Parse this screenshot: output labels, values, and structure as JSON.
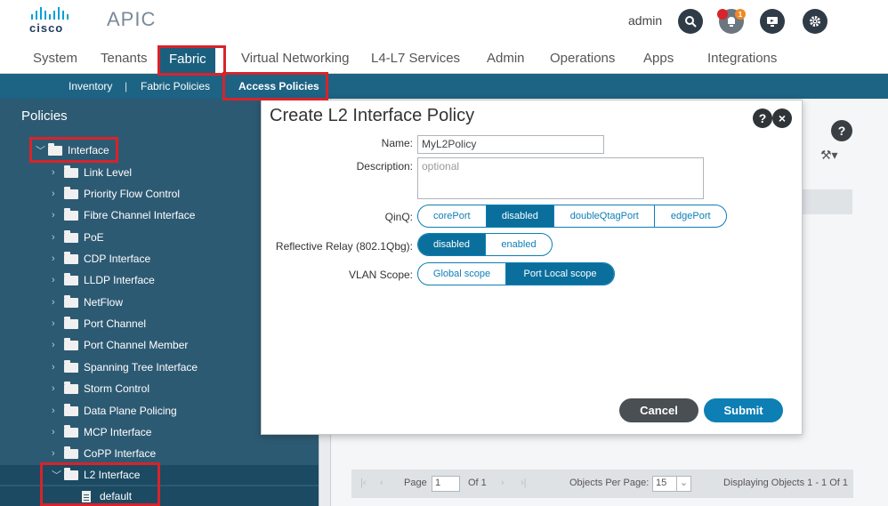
{
  "header": {
    "brand": "cisco",
    "app_title": "APIC",
    "user": "admin",
    "notification_count": "1",
    "icons": [
      "search-icon",
      "bell-icon",
      "screen-icon",
      "gear-icon"
    ]
  },
  "main_nav": {
    "tabs": [
      "System",
      "Tenants",
      "Fabric",
      "Virtual Networking",
      "L4-L7 Services",
      "Admin",
      "Operations",
      "Apps",
      "Integrations"
    ],
    "active": "Fabric"
  },
  "sub_nav": {
    "items": [
      "Inventory",
      "Fabric Policies",
      "Access Policies"
    ],
    "separator": "|",
    "active": "Access Policies"
  },
  "sidebar": {
    "title": "Policies",
    "root": "Interface",
    "items": [
      "Link Level",
      "Priority Flow Control",
      "Fibre Channel Interface",
      "PoE",
      "CDP Interface",
      "LLDP Interface",
      "NetFlow",
      "Port Channel",
      "Port Channel Member",
      "Spanning Tree Interface",
      "Storm Control",
      "Data Plane Policing",
      "MCP Interface",
      "CoPP Interface",
      "L2 Interface"
    ],
    "child": "default"
  },
  "right_pane": {
    "tools_glyph": "⚒▾",
    "pager": {
      "page_label": "Page",
      "page_value": "1",
      "of_label": "Of 1",
      "per_page_label": "Objects Per Page:",
      "per_page_value": "15",
      "display_text": "Displaying Objects 1 - 1 Of 1"
    }
  },
  "dialog": {
    "title": "Create L2 Interface Policy",
    "help": "?",
    "close": "×",
    "name_label": "Name:",
    "name_value": "MyL2Policy",
    "description_label": "Description:",
    "description_placeholder": "optional",
    "qinq_label": "QinQ:",
    "qinq_options": [
      "corePort",
      "disabled",
      "doubleQtagPort",
      "edgePort"
    ],
    "qinq_selected": "disabled",
    "reflective_label": "Reflective Relay (802.1Qbg):",
    "reflective_options": [
      "disabled",
      "enabled"
    ],
    "reflective_selected": "disabled",
    "vlan_label": "VLAN Scope:",
    "vlan_options": [
      "Global scope",
      "Port Local scope"
    ],
    "vlan_selected": "Port Local scope",
    "cancel_label": "Cancel",
    "submit_label": "Submit"
  },
  "colors": {
    "accent": "#0a6f9c",
    "nav_active": "#1b5f7e",
    "subnav_bg": "#1d6384",
    "sidebar_bg": "#2d5a73",
    "highlight": "#d8232a",
    "cancel": "#4a4f54",
    "submit": "#0d7fb5"
  }
}
